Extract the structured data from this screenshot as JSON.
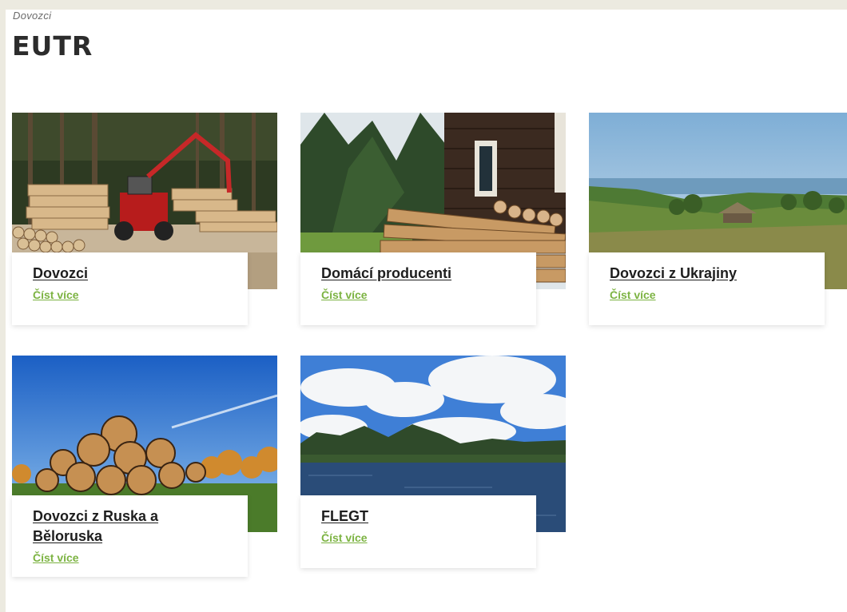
{
  "breadcrumb": "Dovozci",
  "page_title": "EUTR",
  "read_more_label": "Číst více",
  "tiles": [
    {
      "title": "Dovozci",
      "link": "Číst více"
    },
    {
      "title": "Domácí producenti",
      "link": "Číst více"
    },
    {
      "title": "Dovozci z Ukrajiny",
      "link": "Číst více"
    },
    {
      "title": "Dovozci z Ruska a Běloruska",
      "link": "Číst více"
    },
    {
      "title": "FLEGT",
      "link": "Číst více"
    }
  ],
  "colors": {
    "accent_link": "#7cb342",
    "title_text": "#1e1e1e",
    "outer_background": "#eceae0"
  }
}
